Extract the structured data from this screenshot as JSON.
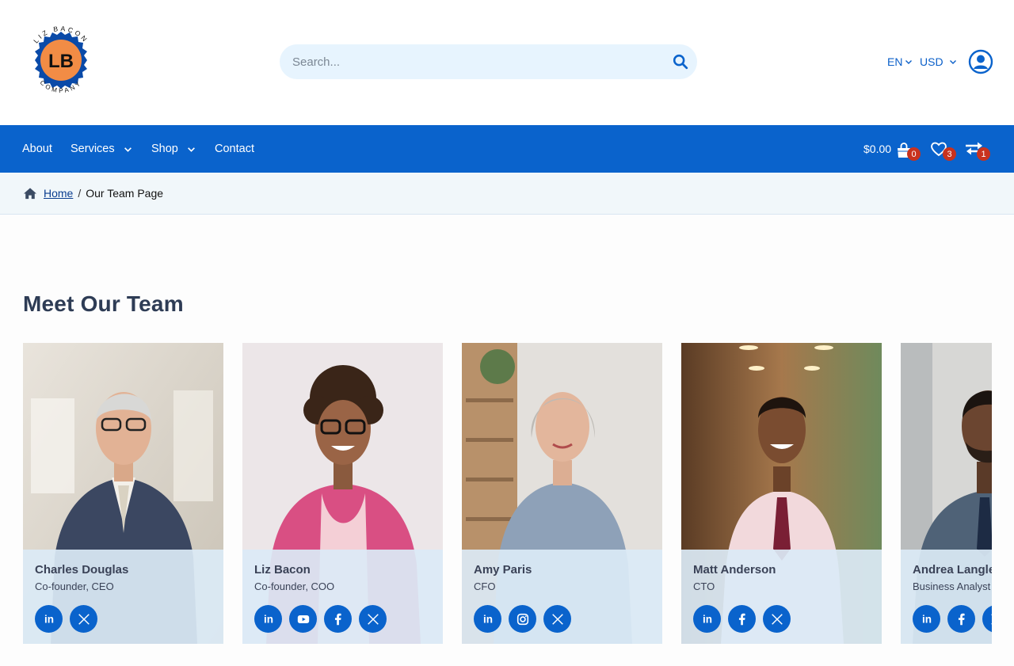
{
  "brand": {
    "logo_text": "LB",
    "logo_ring_text": "LIZ BACON COMPANY"
  },
  "search": {
    "placeholder": "Search..."
  },
  "header": {
    "language": "EN",
    "currency": "USD"
  },
  "nav": {
    "items": [
      {
        "label": "About",
        "has_dropdown": false
      },
      {
        "label": "Services",
        "has_dropdown": true
      },
      {
        "label": "Shop",
        "has_dropdown": true
      },
      {
        "label": "Contact",
        "has_dropdown": false
      }
    ],
    "cart_total": "$0.00",
    "cart_count": "0",
    "wishlist_count": "3",
    "compare_count": "1"
  },
  "breadcrumb": {
    "home": "Home",
    "separator": "/",
    "current": "Our Team Page"
  },
  "team": {
    "title": "Meet Our Team",
    "members": [
      {
        "name": "Charles Douglas",
        "role": "Co-founder, CEO",
        "socials": [
          "linkedin-icon",
          "x-icon"
        ]
      },
      {
        "name": "Liz Bacon",
        "role": "Co-founder, COO",
        "socials": [
          "linkedin-icon",
          "youtube-icon",
          "facebook-icon",
          "x-icon"
        ]
      },
      {
        "name": "Amy Paris",
        "role": "CFO",
        "socials": [
          "linkedin-icon",
          "instagram-icon",
          "x-icon"
        ]
      },
      {
        "name": "Matt Anderson",
        "role": "CTO",
        "socials": [
          "linkedin-icon",
          "facebook-icon",
          "x-icon"
        ]
      },
      {
        "name": "Andrea Langley",
        "role": "Business Analyst",
        "socials": [
          "linkedin-icon",
          "facebook-icon",
          "x-icon"
        ]
      }
    ]
  },
  "colors": {
    "primary": "#0a63cc",
    "badge": "#c8321e",
    "search_bg": "#e7f4fe",
    "card_info_bg": "#dbeaf6",
    "logo_orange": "#f28c45"
  }
}
